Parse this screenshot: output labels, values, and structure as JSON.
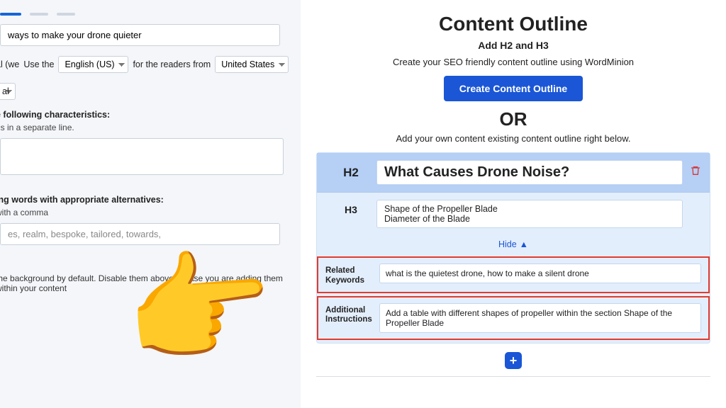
{
  "left": {
    "topic_value": "ways to make your drone quieter",
    "tone_fragment": "al (we",
    "use_the_label": "Use the",
    "language_value": "English (US)",
    "readers_from_label": "for the readers from",
    "country_value": "United States",
    "al_tag": "al",
    "characteristics_label": "e following characteristics:",
    "characteristics_hint": "ns in a separate line.",
    "alternatives_label": "ing words with appropriate alternatives:",
    "alternatives_hint": "with a comma",
    "alternatives_value": "es, realm, bespoke, tailored, towards,",
    "footer_note": "the background by default. Disable them above in case you are adding them within your content"
  },
  "right": {
    "title": "Content Outline",
    "subtitle": "Add H2 and H3",
    "desc": "Create your SEO friendly content outline using WordMinion",
    "create_btn": "Create Content Outline",
    "or_label": "OR",
    "desc2": "Add your own content existing content outline right below.",
    "h2_label": "H2",
    "h2_value": "What Causes Drone Noise?",
    "h3_label": "H3",
    "h3_value": "Shape of the Propeller Blade\nDiameter of the Blade",
    "hide_label": "Hide",
    "related_kw_label": "Related Keywords",
    "related_kw_value": "what is the quietest drone, how to make a silent drone",
    "addl_instr_label": "Additional Instructions",
    "addl_instr_value": "Add a table with different shapes of propeller within the section Shape of the Propeller Blade"
  }
}
